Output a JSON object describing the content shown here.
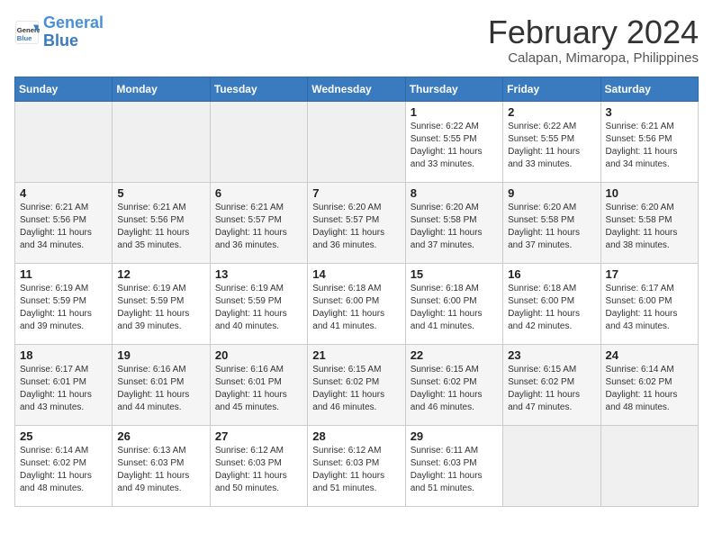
{
  "header": {
    "logo_line1": "General",
    "logo_line2": "Blue",
    "title": "February 2024",
    "subtitle": "Calapan, Mimaropa, Philippines"
  },
  "days_of_week": [
    "Sunday",
    "Monday",
    "Tuesday",
    "Wednesday",
    "Thursday",
    "Friday",
    "Saturday"
  ],
  "weeks": [
    [
      {
        "day": "",
        "info": ""
      },
      {
        "day": "",
        "info": ""
      },
      {
        "day": "",
        "info": ""
      },
      {
        "day": "",
        "info": ""
      },
      {
        "day": "1",
        "info": "Sunrise: 6:22 AM\nSunset: 5:55 PM\nDaylight: 11 hours and 33 minutes."
      },
      {
        "day": "2",
        "info": "Sunrise: 6:22 AM\nSunset: 5:55 PM\nDaylight: 11 hours and 33 minutes."
      },
      {
        "day": "3",
        "info": "Sunrise: 6:21 AM\nSunset: 5:56 PM\nDaylight: 11 hours and 34 minutes."
      }
    ],
    [
      {
        "day": "4",
        "info": "Sunrise: 6:21 AM\nSunset: 5:56 PM\nDaylight: 11 hours and 34 minutes."
      },
      {
        "day": "5",
        "info": "Sunrise: 6:21 AM\nSunset: 5:56 PM\nDaylight: 11 hours and 35 minutes."
      },
      {
        "day": "6",
        "info": "Sunrise: 6:21 AM\nSunset: 5:57 PM\nDaylight: 11 hours and 36 minutes."
      },
      {
        "day": "7",
        "info": "Sunrise: 6:20 AM\nSunset: 5:57 PM\nDaylight: 11 hours and 36 minutes."
      },
      {
        "day": "8",
        "info": "Sunrise: 6:20 AM\nSunset: 5:58 PM\nDaylight: 11 hours and 37 minutes."
      },
      {
        "day": "9",
        "info": "Sunrise: 6:20 AM\nSunset: 5:58 PM\nDaylight: 11 hours and 37 minutes."
      },
      {
        "day": "10",
        "info": "Sunrise: 6:20 AM\nSunset: 5:58 PM\nDaylight: 11 hours and 38 minutes."
      }
    ],
    [
      {
        "day": "11",
        "info": "Sunrise: 6:19 AM\nSunset: 5:59 PM\nDaylight: 11 hours and 39 minutes."
      },
      {
        "day": "12",
        "info": "Sunrise: 6:19 AM\nSunset: 5:59 PM\nDaylight: 11 hours and 39 minutes."
      },
      {
        "day": "13",
        "info": "Sunrise: 6:19 AM\nSunset: 5:59 PM\nDaylight: 11 hours and 40 minutes."
      },
      {
        "day": "14",
        "info": "Sunrise: 6:18 AM\nSunset: 6:00 PM\nDaylight: 11 hours and 41 minutes."
      },
      {
        "day": "15",
        "info": "Sunrise: 6:18 AM\nSunset: 6:00 PM\nDaylight: 11 hours and 41 minutes."
      },
      {
        "day": "16",
        "info": "Sunrise: 6:18 AM\nSunset: 6:00 PM\nDaylight: 11 hours and 42 minutes."
      },
      {
        "day": "17",
        "info": "Sunrise: 6:17 AM\nSunset: 6:00 PM\nDaylight: 11 hours and 43 minutes."
      }
    ],
    [
      {
        "day": "18",
        "info": "Sunrise: 6:17 AM\nSunset: 6:01 PM\nDaylight: 11 hours and 43 minutes."
      },
      {
        "day": "19",
        "info": "Sunrise: 6:16 AM\nSunset: 6:01 PM\nDaylight: 11 hours and 44 minutes."
      },
      {
        "day": "20",
        "info": "Sunrise: 6:16 AM\nSunset: 6:01 PM\nDaylight: 11 hours and 45 minutes."
      },
      {
        "day": "21",
        "info": "Sunrise: 6:15 AM\nSunset: 6:02 PM\nDaylight: 11 hours and 46 minutes."
      },
      {
        "day": "22",
        "info": "Sunrise: 6:15 AM\nSunset: 6:02 PM\nDaylight: 11 hours and 46 minutes."
      },
      {
        "day": "23",
        "info": "Sunrise: 6:15 AM\nSunset: 6:02 PM\nDaylight: 11 hours and 47 minutes."
      },
      {
        "day": "24",
        "info": "Sunrise: 6:14 AM\nSunset: 6:02 PM\nDaylight: 11 hours and 48 minutes."
      }
    ],
    [
      {
        "day": "25",
        "info": "Sunrise: 6:14 AM\nSunset: 6:02 PM\nDaylight: 11 hours and 48 minutes."
      },
      {
        "day": "26",
        "info": "Sunrise: 6:13 AM\nSunset: 6:03 PM\nDaylight: 11 hours and 49 minutes."
      },
      {
        "day": "27",
        "info": "Sunrise: 6:12 AM\nSunset: 6:03 PM\nDaylight: 11 hours and 50 minutes."
      },
      {
        "day": "28",
        "info": "Sunrise: 6:12 AM\nSunset: 6:03 PM\nDaylight: 11 hours and 51 minutes."
      },
      {
        "day": "29",
        "info": "Sunrise: 6:11 AM\nSunset: 6:03 PM\nDaylight: 11 hours and 51 minutes."
      },
      {
        "day": "",
        "info": ""
      },
      {
        "day": "",
        "info": ""
      }
    ]
  ]
}
